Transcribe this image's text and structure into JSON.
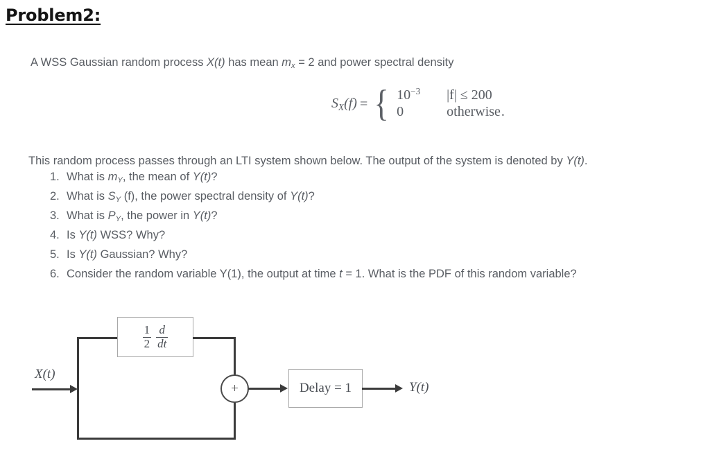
{
  "document": {
    "title": "Problem2:",
    "intro": {
      "prefix": "A WSS Gaussian random process ",
      "process_symbol": "X(t)",
      "middle": " has mean ",
      "mean_symbol": "m",
      "mean_subscript": "x",
      "mean_value": " = 2 and power spectral density"
    },
    "equation": {
      "lhs_symbol": "S",
      "lhs_subscript": "X",
      "lhs_arg": "(f)",
      "equals": "=",
      "brace": "{",
      "case1_value": "10",
      "case1_exponent": "−3",
      "case1_condition": "|f| ≤ 200",
      "case2_value": "0",
      "case2_condition": "otherwise",
      "trailing_period": "."
    },
    "lti_line": {
      "text_a": "This random process passes through an LTI system shown below. The output of the system is denoted by ",
      "symbol": "Y(t)",
      "text_b": "."
    },
    "questions": [
      {
        "number": "1.",
        "prefix": "What is ",
        "symbol": "m",
        "subscript": "Y",
        "suffix": ", the mean of ",
        "symbol2": "Y(t)",
        "tail": "?"
      },
      {
        "number": "2.",
        "prefix": "What is ",
        "symbol": "S",
        "subscript": "Y",
        "suffix": " (f), the power spectral density of ",
        "symbol2": "Y(t)",
        "tail": "?"
      },
      {
        "number": "3.",
        "prefix": "What is ",
        "symbol": "P",
        "subscript": "Y",
        "suffix": ", the power in ",
        "symbol2": "Y(t)",
        "tail": "?"
      },
      {
        "number": "4.",
        "prefix": "Is ",
        "symbol": "",
        "subscript": "",
        "suffix": "",
        "symbol2": "Y(t)",
        "tail": " WSS? Why?"
      },
      {
        "number": "5.",
        "prefix": "Is ",
        "symbol": "",
        "subscript": "",
        "suffix": "",
        "symbol2": "Y(t)",
        "tail": " Gaussian? Why?"
      },
      {
        "number": "6.",
        "prefix": "Consider the random variable Y(1), the output at time ",
        "symbol": "t",
        "subscript": "",
        "suffix": " = 1. What is the PDF of this random variable?",
        "symbol2": "",
        "tail": ""
      }
    ]
  },
  "diagram": {
    "input_label": "X(t)",
    "output_label": "Y(t)",
    "derivative_block": {
      "coefficient_numerator": "1",
      "coefficient_denominator": "2",
      "operator_numerator": "d",
      "operator_denominator": "dt"
    },
    "delay_block_label": "Delay = 1",
    "summer_sign": "+"
  },
  "colors": {
    "page_background": "#ffffff",
    "title_text": "#151515",
    "body_text": "#595d63",
    "diagram_line": "#3b3b3b",
    "diagram_box_border": "#a8a8a8",
    "diagram_text": "#4a4e54"
  }
}
